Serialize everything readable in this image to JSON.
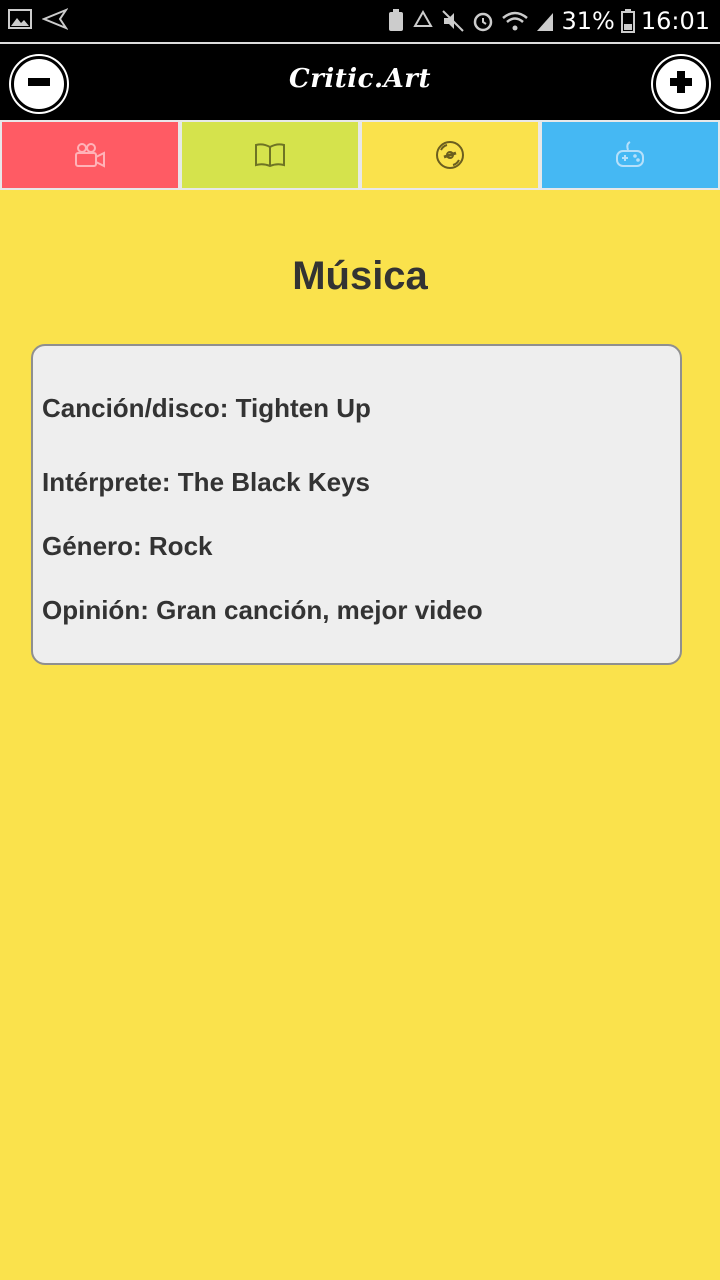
{
  "status_bar": {
    "battery": "31%",
    "time": "16:01",
    "icons": [
      "gallery-icon",
      "send-icon",
      "battery-saver-icon",
      "recycle-icon",
      "mute-icon",
      "alarm-icon",
      "wifi-icon",
      "signal-icon",
      "battery-icon"
    ]
  },
  "app_bar": {
    "title": "Critic.Art",
    "left_button_icon": "minus-circle-icon",
    "right_button_icon": "plus-circle-icon"
  },
  "tabs": [
    {
      "id": "movies",
      "icon": "video-camera-icon",
      "color": "#FF5B64"
    },
    {
      "id": "books",
      "icon": "book-icon",
      "color": "#D5E34C"
    },
    {
      "id": "music",
      "icon": "disc-icon",
      "color": "#FAE24C",
      "selected": true
    },
    {
      "id": "games",
      "icon": "gamepad-icon",
      "color": "#45B8F3"
    }
  ],
  "main": {
    "title": "Música",
    "review": {
      "song": "Canción/disco: Tighten Up",
      "artist": "Intérprete: The Black Keys",
      "genre": "Género: Rock",
      "opinion": "Opinión: Gran canción, mejor video"
    }
  },
  "colors": {
    "background": "#FAE24C",
    "card": "#EEEEEE",
    "text": "#333333"
  }
}
